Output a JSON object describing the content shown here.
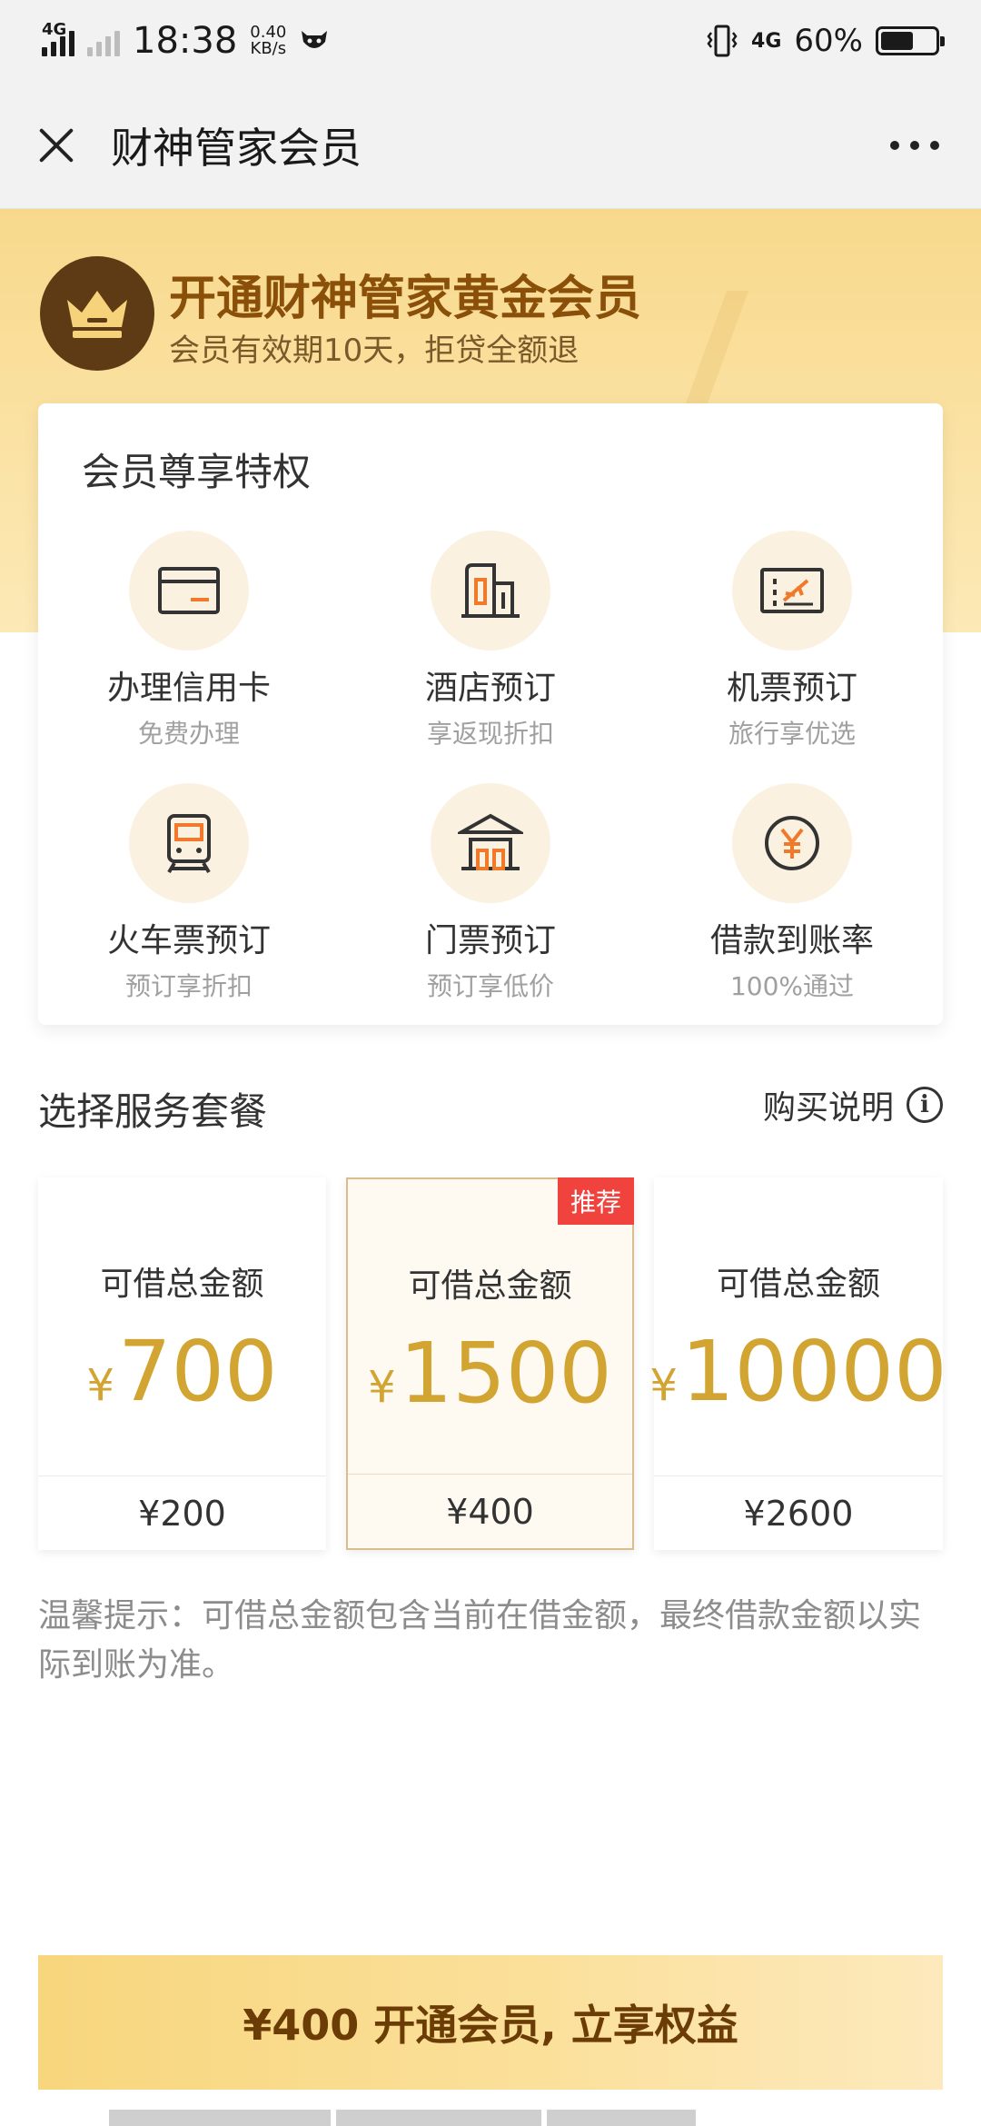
{
  "status_bar": {
    "network_left": "4G",
    "time": "18:38",
    "speed_value": "0.40",
    "speed_unit": "KB/s",
    "network_right": "4G",
    "battery_percent": "60%",
    "battery_level": 0.6
  },
  "nav": {
    "title": "财神管家会员"
  },
  "hero": {
    "title": "开通财神管家黄金会员",
    "subtitle": "会员有效期10天，拒贷全额退"
  },
  "privileges": {
    "title": "会员尊享特权",
    "items": [
      {
        "name": "办理信用卡",
        "desc": "免费办理",
        "icon": "credit-card-icon"
      },
      {
        "name": "酒店预订",
        "desc": "享返现折扣",
        "icon": "hotel-icon"
      },
      {
        "name": "机票预订",
        "desc": "旅行享优选",
        "icon": "flight-ticket-icon"
      },
      {
        "name": "火车票预订",
        "desc": "预订享折扣",
        "icon": "train-icon"
      },
      {
        "name": "门票预订",
        "desc": "预订享低价",
        "icon": "attraction-ticket-icon"
      },
      {
        "name": "借款到账率",
        "desc": "100%通过",
        "icon": "yuan-coin-icon"
      }
    ]
  },
  "packages": {
    "title": "选择服务套餐",
    "buy_info_label": "购买说明",
    "currency_symbol": "¥",
    "recommend_badge": "推荐",
    "selected_index": 1,
    "items": [
      {
        "label": "可借总金额",
        "amount": "700",
        "price": "¥200"
      },
      {
        "label": "可借总金额",
        "amount": "1500",
        "price": "¥400"
      },
      {
        "label": "可借总金额",
        "amount": "10000",
        "price": "¥2600"
      }
    ]
  },
  "tip": "温馨提示：可借总金额包含当前在借金额，最终借款金额以实际到账为准。",
  "cta": {
    "label": "¥400 开通会员, 立享权益"
  },
  "colors": {
    "accent_gold": "#d2a431",
    "hero_bg": "#f8d98c",
    "badge_red": "#f0433d",
    "title_brown": "#8a4f08"
  }
}
